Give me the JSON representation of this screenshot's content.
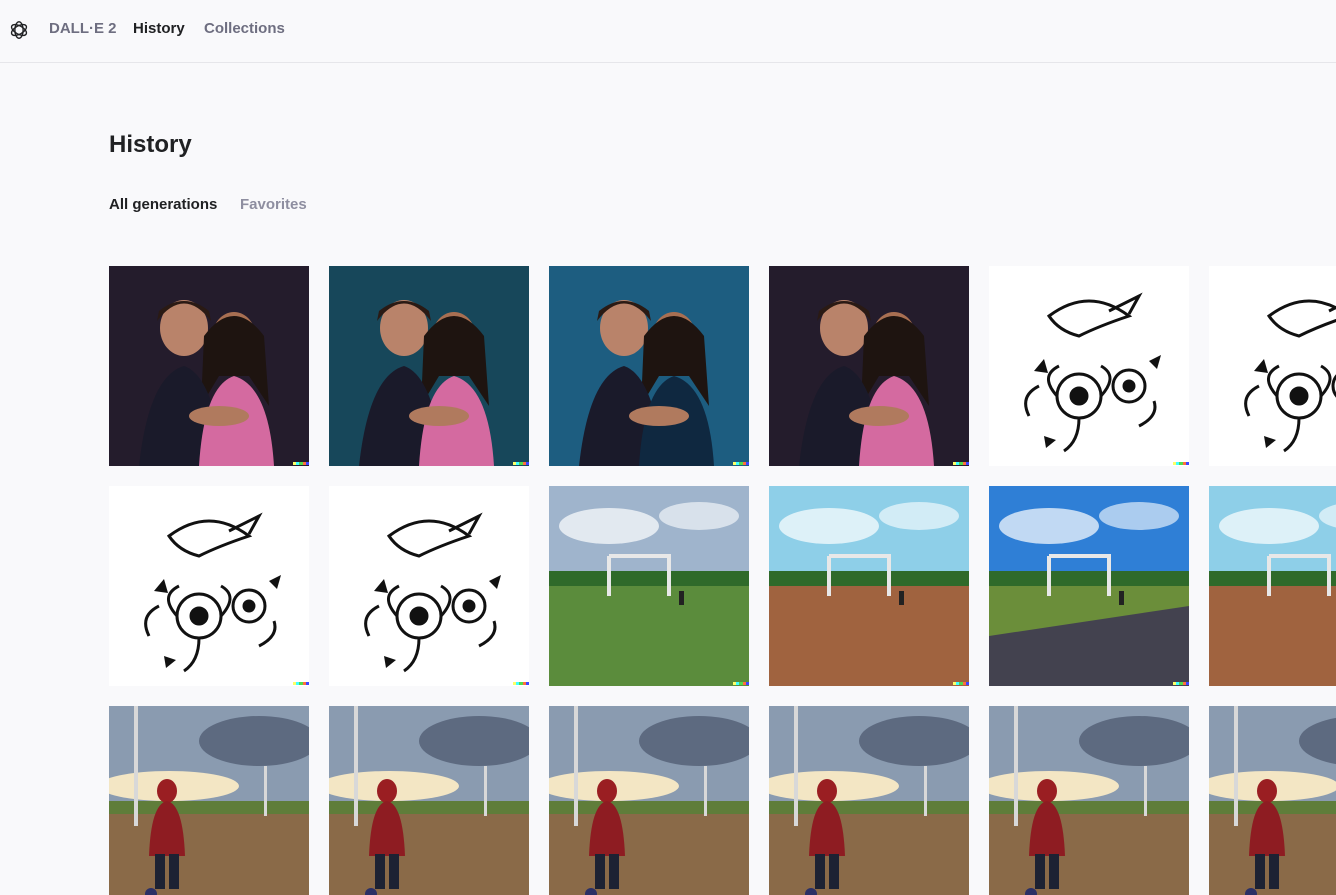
{
  "nav": {
    "brand": "DALL·E 2",
    "history": "History",
    "collections": "Collections"
  },
  "page": {
    "title": "History",
    "tabs": [
      {
        "label": "All generations",
        "active": true
      },
      {
        "label": "Favorites",
        "active": false
      }
    ]
  },
  "colors": {
    "accent_text": "#202123",
    "muted_text": "#6e6e80",
    "background": "#f9f9fb",
    "signature": [
      "#ffff66",
      "#42ffff",
      "#51da4c",
      "#ff6e3c",
      "#3c46ff"
    ]
  },
  "icons": {
    "logo": "openai-logo-icon"
  },
  "gallery": {
    "rows": [
      [
        {
          "subject": "couple-photo",
          "style": "portrait-dark"
        },
        {
          "subject": "couple-photo",
          "style": "portrait-teal"
        },
        {
          "subject": "couple-photo",
          "style": "portrait-blue"
        },
        {
          "subject": "couple-photo",
          "style": "portrait-dark"
        },
        {
          "subject": "bird-flower-tattoo",
          "style": "ink"
        },
        {
          "subject": "bird-flower-tattoo",
          "style": "ink"
        }
      ],
      [
        {
          "subject": "bird-flower-tattoo",
          "style": "ink"
        },
        {
          "subject": "bird-flower-tattoo",
          "style": "ink"
        },
        {
          "subject": "soccer-field",
          "style": "cloudy"
        },
        {
          "subject": "soccer-field",
          "style": "dirt"
        },
        {
          "subject": "soccer-field",
          "style": "sunny"
        },
        {
          "subject": "soccer-field",
          "style": "dirt"
        }
      ],
      [
        {
          "subject": "person-at-field",
          "style": "dusk"
        },
        {
          "subject": "person-at-field",
          "style": "dusk"
        },
        {
          "subject": "person-at-field",
          "style": "dusk"
        },
        {
          "subject": "person-at-field",
          "style": "dusk"
        },
        {
          "subject": "person-at-field",
          "style": "dusk"
        },
        {
          "subject": "person-at-field",
          "style": "dusk"
        }
      ]
    ]
  }
}
